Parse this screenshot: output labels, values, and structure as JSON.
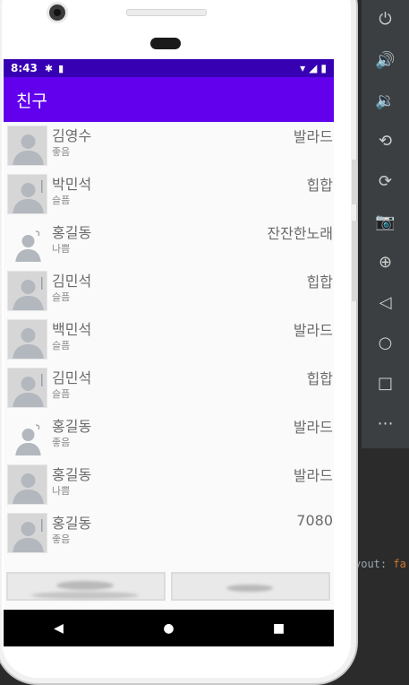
{
  "status_bar": {
    "time": "8:43",
    "icons_left": [
      "gear-icon",
      "sd-card-icon"
    ],
    "icons_right": [
      "wifi-icon",
      "signal-icon",
      "battery-icon"
    ]
  },
  "app_bar": {
    "title": "친구"
  },
  "friends": [
    {
      "name": "김영수",
      "mood": "좋음",
      "genre": "발라드",
      "avatar": "person-placeholder-icon"
    },
    {
      "name": "박민석",
      "mood": "슬픔",
      "genre": "힙합",
      "avatar": "person-placeholder-icon"
    },
    {
      "name": "홍길동",
      "mood": "나쁨",
      "genre": "잔잔한노래",
      "avatar": "person-placeholder-icon"
    },
    {
      "name": "김민석",
      "mood": "슬픔",
      "genre": "힙합",
      "avatar": "person-placeholder-icon"
    },
    {
      "name": "백민석",
      "mood": "슬픔",
      "genre": "발라드",
      "avatar": "person-placeholder-icon"
    },
    {
      "name": "김민석",
      "mood": "슬픔",
      "genre": "힙합",
      "avatar": "person-placeholder-icon"
    },
    {
      "name": "홍길동",
      "mood": "좋음",
      "genre": "발라드",
      "avatar": "person-placeholder-icon"
    },
    {
      "name": "홍길동",
      "mood": "나쁨",
      "genre": "발라드",
      "avatar": "person-placeholder-icon"
    },
    {
      "name": "홍길동",
      "mood": "좋음",
      "genre": "7080",
      "avatar": "person-placeholder-icon"
    }
  ],
  "bottom_buttons": [
    {
      "label": "",
      "icon": "blurred-button-content"
    },
    {
      "label": "",
      "icon": "blurred-button-content"
    }
  ],
  "nav_bar": {
    "back": "◀",
    "home": "●",
    "recents": "■"
  },
  "emulator_toolbar": [
    {
      "name": "power-icon",
      "glyph": "⏻"
    },
    {
      "name": "volume-up-icon",
      "glyph": "🔊"
    },
    {
      "name": "volume-down-icon",
      "glyph": "🔉"
    },
    {
      "name": "rotate-left-icon",
      "glyph": "⟲"
    },
    {
      "name": "rotate-right-icon",
      "glyph": "⟳"
    },
    {
      "name": "camera-icon",
      "glyph": "📷"
    },
    {
      "name": "zoom-icon",
      "glyph": "⊕"
    },
    {
      "name": "back-icon",
      "glyph": "◁"
    },
    {
      "name": "home-icon",
      "glyph": "○"
    },
    {
      "name": "overview-icon",
      "glyph": "□"
    },
    {
      "name": "more-icon",
      "glyph": "⋯"
    }
  ],
  "ide_hint": {
    "key": "yout:",
    "value": "fa"
  }
}
